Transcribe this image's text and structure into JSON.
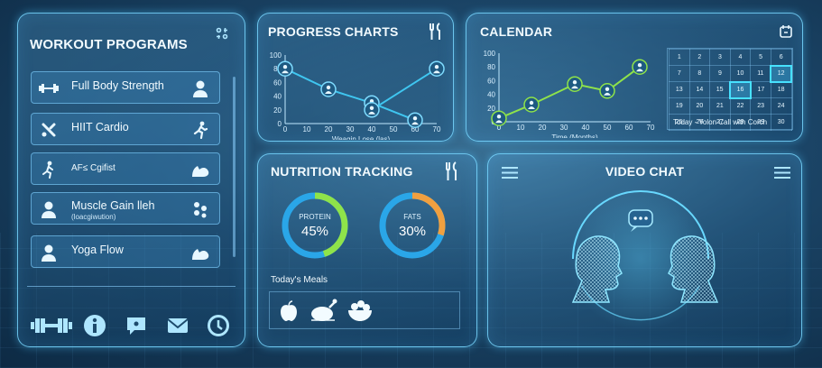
{
  "workout": {
    "title": "WORKOUT PROGRAMS",
    "items": [
      {
        "label": "Full Body Strength",
        "sub": ""
      },
      {
        "label": "HIIT Cardio",
        "sub": ""
      },
      {
        "label": "AF≤ Cgifist",
        "sub": ""
      },
      {
        "label": "Muscle Gain lleh",
        "sub": "(loacgiwution)"
      },
      {
        "label": "Yoga Flow",
        "sub": ""
      }
    ],
    "bottom_icons": [
      "dumbbell-icon",
      "info-icon",
      "chat-bubble-icon",
      "mail-icon",
      "clock-icon"
    ]
  },
  "progress": {
    "title": "PROGRESS CHARTS",
    "xlabel": "Weagin Lose (las)",
    "yticks": [
      "100",
      "80",
      "60",
      "40",
      "20",
      "0"
    ],
    "xticks": [
      "0",
      "10",
      "20",
      "30",
      "40",
      "50",
      "60",
      "70"
    ]
  },
  "calendar": {
    "title": "CALENDAR",
    "xlabel": "Time (Months)",
    "yticks": [
      "100",
      "80",
      "60",
      "40",
      "20",
      "0"
    ],
    "xticks": [
      "0",
      "10",
      "20",
      "30",
      "40",
      "50",
      "60",
      "70"
    ],
    "grid": [
      [
        "1",
        "2",
        "3",
        "4",
        "5",
        "6"
      ],
      [
        "7",
        "8",
        "9",
        "10",
        "11",
        "12"
      ],
      [
        "13",
        "14",
        "15",
        "16",
        "17",
        "18"
      ],
      [
        "19",
        "20",
        "21",
        "22",
        "23",
        "24"
      ],
      [
        "25",
        "26",
        "27",
        "28",
        "29",
        "30"
      ]
    ],
    "event": "Today - Yolon Call with Corch"
  },
  "nutrition": {
    "title": "NUTRITION TRACKING",
    "rings": [
      {
        "label": "PROTEIN",
        "value": "45%",
        "percent": 45,
        "color": "#8fe34a"
      },
      {
        "label": "FATS",
        "value": "30%",
        "percent": 30,
        "color": "#f0a040"
      }
    ],
    "meals_label": "Today's Meals"
  },
  "video": {
    "title": "VIDEO CHAT"
  },
  "chart_data": [
    {
      "type": "line",
      "title": "PROGRESS CHARTS",
      "xlabel": "Weagin Lose (las)",
      "ylim": [
        0,
        100
      ],
      "series": [
        {
          "x": [
            0,
            20,
            40,
            60
          ],
          "values": [
            80,
            50,
            30,
            5
          ],
          "color": "#3fc6f0"
        },
        {
          "x": [
            40,
            70
          ],
          "values": [
            20,
            80
          ],
          "color": "#3fc6f0"
        }
      ]
    },
    {
      "type": "line",
      "title": "CALENDAR",
      "xlabel": "Time (Months)",
      "ylim": [
        0,
        100
      ],
      "series": [
        {
          "x": [
            0,
            15,
            35,
            50,
            65
          ],
          "values": [
            5,
            25,
            55,
            45,
            80
          ],
          "color": "#8fe34a"
        }
      ]
    }
  ]
}
